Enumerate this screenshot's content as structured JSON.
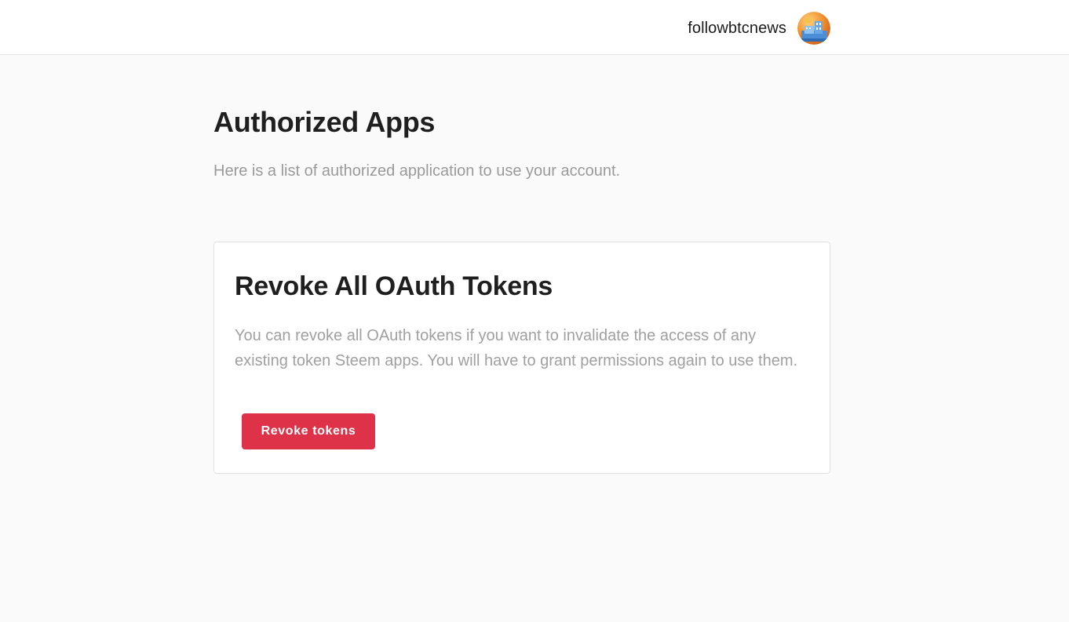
{
  "header": {
    "username": "followbtcnews",
    "avatar_icon": "user-avatar-icon"
  },
  "main": {
    "title": "Authorized Apps",
    "subtitle": "Here is a list of authorized application to use your account."
  },
  "revoke_card": {
    "title": "Revoke All OAuth Tokens",
    "description": "You can revoke all OAuth tokens if you want to invalidate the access of any existing token Steem apps. You will have to grant permissions again to use them.",
    "button_label": "Revoke tokens"
  },
  "colors": {
    "accent": "#de3248",
    "page_background": "#fafafa",
    "card_background": "#ffffff",
    "muted_text": "#9a9a9a"
  }
}
